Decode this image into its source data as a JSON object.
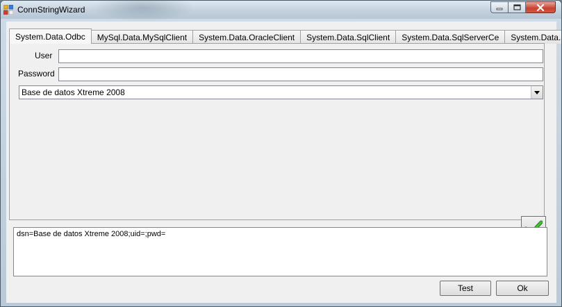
{
  "window": {
    "title": "ConnStringWizard",
    "app_icon": "application-icon",
    "buttons": {
      "minimize_icon": "minimize-icon",
      "maximize_icon": "maximize-icon",
      "close_icon": "close-icon"
    }
  },
  "tabs": [
    {
      "label": "System.Data.Odbc",
      "active": true
    },
    {
      "label": "MySql.Data.MySqlClient",
      "active": false
    },
    {
      "label": "System.Data.OracleClient",
      "active": false
    },
    {
      "label": "System.Data.SqlClient",
      "active": false
    },
    {
      "label": "System.Data.SqlServerCe",
      "active": false
    },
    {
      "label": "System.Data.SQLite",
      "active": false
    }
  ],
  "form": {
    "user_label": "User",
    "user_value": "",
    "password_label": "Password",
    "password_value": "",
    "dsn_selected": "Base de datos Xtreme 2008",
    "accept_icon": "green-checkmark-icon"
  },
  "output": {
    "connection_string": "dsn=Base de datos Xtreme 2008;uid=;pwd="
  },
  "footer": {
    "test_label": "Test",
    "ok_label": "Ok"
  },
  "colors": {
    "accent_check": "#2f9a2f",
    "close_button": "#c8402e"
  }
}
